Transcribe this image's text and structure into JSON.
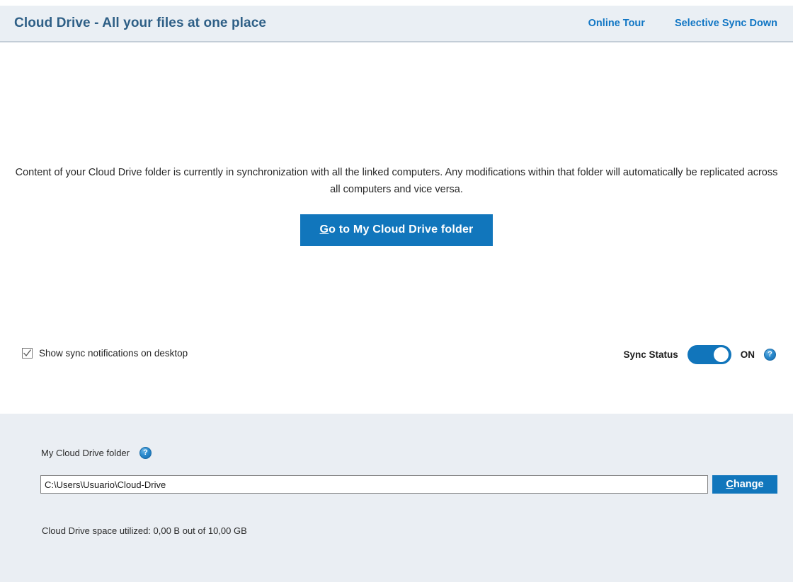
{
  "header": {
    "title": "Cloud Drive - All your files at one place",
    "links": [
      {
        "label": "Online Tour",
        "name": "online-tour-link"
      },
      {
        "label": "Selective Sync Down",
        "name": "selective-sync-down-link"
      }
    ],
    "bg_color": "#eaeff4",
    "title_color": "#2e5f86",
    "link_color": "#1176c4"
  },
  "main": {
    "intro_text": "Content of your Cloud Drive folder is currently in synchronization with all the linked computers. Any modifications within that folder will automatically be replicated across all computers and vice versa.",
    "primary_button": {
      "accel_letter": "G",
      "label_rest": "o to My Cloud Drive folder",
      "full_label": "Go to My Cloud Drive folder",
      "color": "#1176bc"
    },
    "notifications_checkbox": {
      "label": "Show sync notifications on desktop",
      "checked": true
    },
    "sync_status": {
      "label": "Sync Status",
      "state": "ON",
      "enabled": true,
      "toggle_color": "#1175bb",
      "help_icon": "help-question-icon"
    }
  },
  "bottom_panel": {
    "folder_label": "My Cloud Drive folder",
    "folder_help_icon": "help-question-icon",
    "path_value": "C:\\Users\\Usuario\\Cloud-Drive",
    "path_placeholder": "C:\\Users\\Usuario\\Cloud-Drive",
    "change_button": {
      "accel_letter": "C",
      "label_rest": "hange",
      "full_label": "Change"
    },
    "space_text": "Cloud Drive space utilized: 0,00 B out of 10,00 GB",
    "bg_color": "#eaeef3"
  }
}
